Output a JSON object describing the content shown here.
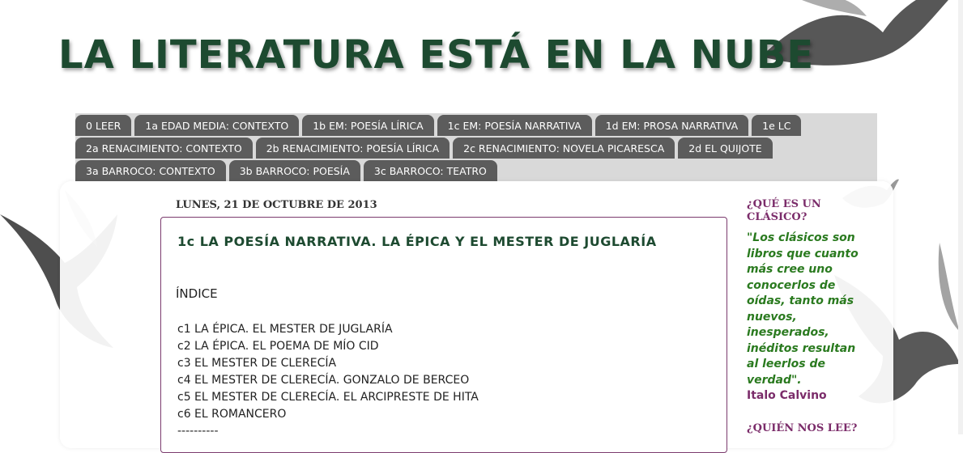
{
  "blog": {
    "title": "LA LITERATURA ESTÁ EN LA NUBE"
  },
  "tabs": {
    "row1": [
      "0 LEER",
      "1a EDAD MEDIA: CONTEXTO",
      "1b EM: POESÍA LÍRICA",
      "1c EM: POESÍA NARRATIVA",
      "1d EM: PROSA NARRATIVA",
      "1e LC"
    ],
    "row2": [
      "2a RENACIMIENTO: CONTEXTO",
      "2b RENACIMIENTO: POESÍA LÍRICA",
      "2c RENACIMIENTO: NOVELA PICARESCA",
      "2d EL QUIJOTE"
    ],
    "row3": [
      "3a BARROCO: CONTEXTO",
      "3b BARROCO: POESÍA",
      "3c BARROCO: TEATRO"
    ]
  },
  "post": {
    "date": "LUNES, 21 DE OCTUBRE DE 2013",
    "title": "1c LA POESÍA NARRATIVA. LA ÉPICA Y EL MESTER DE JUGLARÍA",
    "indice": "ÍNDICE",
    "items": [
      "c1 LA ÉPICA. EL MESTER DE JUGLARÍA",
      "c2 LA ÉPICA. EL POEMA DE MÍO CID",
      "c3 EL MESTER DE CLERECÍA",
      "c4 EL MESTER DE CLERECÍA. GONZALO DE BERCEO",
      "c5 EL MESTER DE CLERECÍA. EL ARCIPRESTE DE HITA",
      "c6 EL ROMANCERO",
      "----------"
    ]
  },
  "sidebar": {
    "heading1": "¿QUÉ ES UN CLÁSICO?",
    "quote": "\"Los clásicos son libros que cuanto más cree uno conocerlos de oídas, tanto más nuevos, inesperados, inéditos resultan al leerlos de verdad\".",
    "author": "Italo Calvino",
    "heading2": "¿QUIÉN NOS LEE?"
  },
  "colors": {
    "title_green": "#1d4a30",
    "tab_bg": "#5c5c5c",
    "tab_bar_bg": "#d9d9d9",
    "accent_purple": "#7b2c6a",
    "quote_green": "#2a7a1f"
  }
}
